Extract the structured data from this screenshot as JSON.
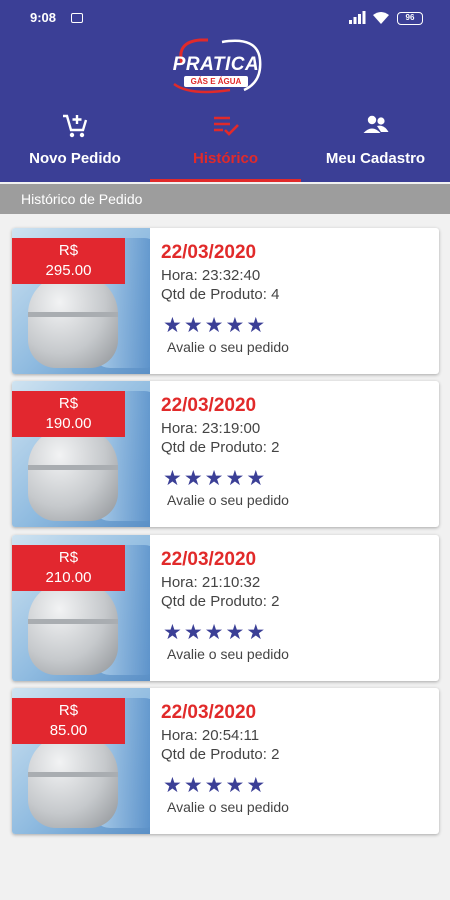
{
  "status_bar": {
    "time": "9:08",
    "battery": "96"
  },
  "app": {
    "logo_text": "PRATICA",
    "logo_sub": "GÁS E ÁGUA"
  },
  "nav": {
    "tabs": [
      {
        "label": "Novo Pedido",
        "icon": "cart-add-icon",
        "active": false
      },
      {
        "label": "Histórico",
        "icon": "list-check-icon",
        "active": true
      },
      {
        "label": "Meu Cadastro",
        "icon": "people-icon",
        "active": false
      }
    ]
  },
  "section": {
    "title": "Histórico de Pedido"
  },
  "orders": [
    {
      "currency": "R$",
      "price": "295.00",
      "date": "22/03/2020",
      "time": "Hora: 23:32:40",
      "qty": "Qtd de Produto: 4",
      "rating_label": "Avalie o seu pedido",
      "stars": 5
    },
    {
      "currency": "R$",
      "price": "190.00",
      "date": "22/03/2020",
      "time": "Hora: 23:19:00",
      "qty": "Qtd de Produto: 2",
      "rating_label": "Avalie o seu pedido",
      "stars": 5
    },
    {
      "currency": "R$",
      "price": "210.00",
      "date": "22/03/2020",
      "time": "Hora: 21:10:32",
      "qty": "Qtd de Produto: 2",
      "rating_label": "Avalie o seu pedido",
      "stars": 5
    },
    {
      "currency": "R$",
      "price": "85.00",
      "date": "22/03/2020",
      "time": "Hora: 20:54:11",
      "qty": "Qtd de Produto: 2",
      "rating_label": "Avalie o seu pedido",
      "stars": 5
    }
  ],
  "colors": {
    "primary": "#3b3f96",
    "accent": "#e12a2a",
    "section_bar": "#9d9d9d"
  }
}
